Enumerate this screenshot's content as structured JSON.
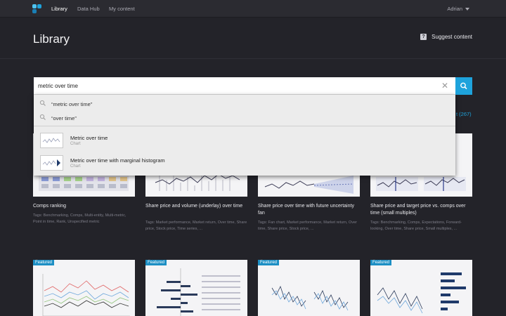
{
  "nav": {
    "items": [
      {
        "label": "Library",
        "active": true
      },
      {
        "label": "Data Hub",
        "active": false
      },
      {
        "label": "My content",
        "active": false
      }
    ],
    "user": "Adrian"
  },
  "header": {
    "title": "Library",
    "suggest_label": "Suggest content"
  },
  "search": {
    "value": "metric over time",
    "clear_icon": "close-icon",
    "button_icon": "search-icon"
  },
  "dropdown": {
    "suggestions": [
      {
        "text": "“metric over time”"
      },
      {
        "text": "“over time”"
      }
    ],
    "results": [
      {
        "title": "Metric over time",
        "type": "Chart"
      },
      {
        "title": "Metric over time with marginal histogram",
        "type": "Chart"
      }
    ]
  },
  "results_count_peek": "t (267)",
  "cards_row1": [
    {
      "title": "Comps ranking",
      "tags": "Tags: Benchmarking, Comps, Multi-entity, Multi-metric, Point in time, Rank, Unspecified metric"
    },
    {
      "title": "Share price and volume (underlay) over time",
      "tags": "Tags: Market performance, Market return, Over time, Share price, Stock price, Time series, ..."
    },
    {
      "title": "Share price over time with future uncertainty fan",
      "tags": "Tags: Fan chart, Market performance, Market return, Over time, Share price, Stock price, ..."
    },
    {
      "title": "Share price and target price vs. comps over time (small multiples)",
      "tags": "Tags: Benchmarking, Comps, Expectations, Forward-looking, Over time, Share price, Small multiples, ..."
    }
  ],
  "cards_row2": [
    {
      "featured": "Featured"
    },
    {
      "featured": "Featured"
    },
    {
      "featured": "Featured"
    },
    {
      "featured": "Featured"
    }
  ],
  "colors": {
    "accent": "#1ea3dc",
    "background": "#232329",
    "featured": "#1d8fc4"
  }
}
